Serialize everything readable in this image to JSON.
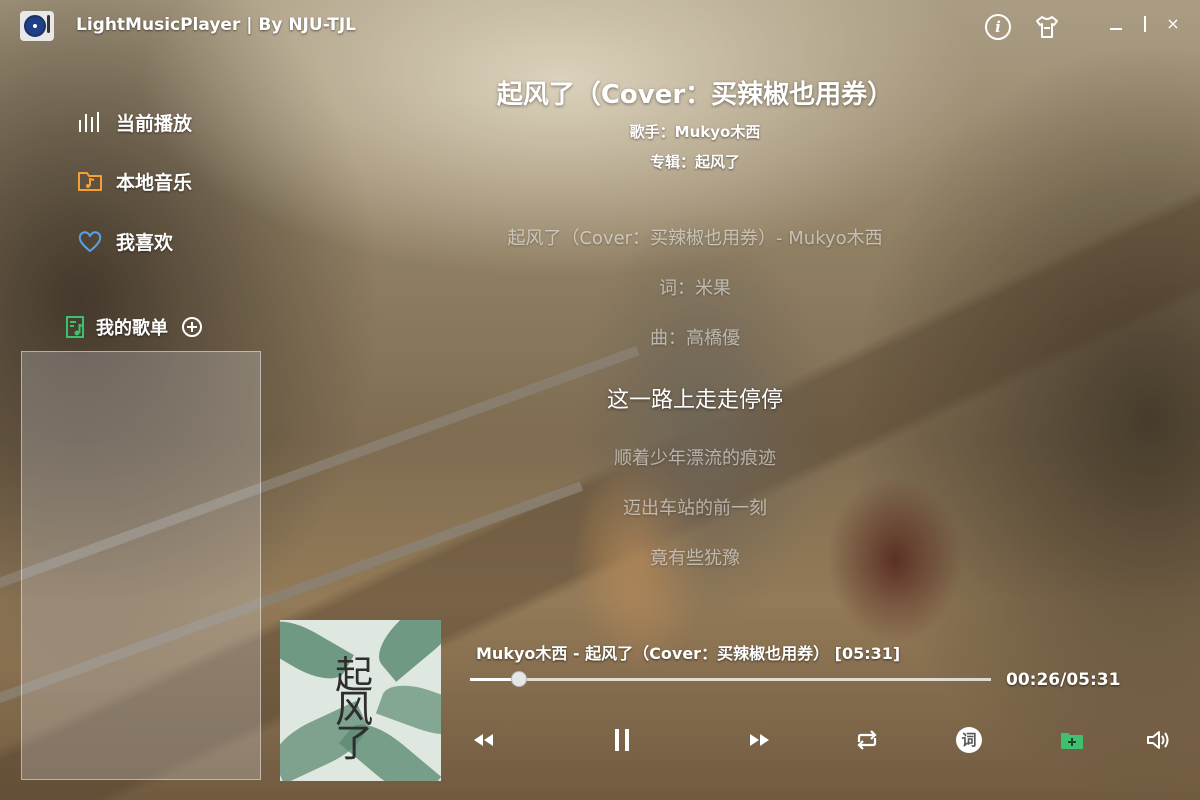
{
  "app": {
    "title": "LightMusicPlayer | By NJU-TJL"
  },
  "titlebar": {
    "info_icon": "info-icon",
    "skin_icon": "tshirt-icon",
    "minimize_icon": "minimize-icon",
    "maximize_icon": "maximize-icon",
    "close_icon": "close-icon",
    "info_glyph": "i",
    "close_glyph": "×"
  },
  "sidebar": {
    "items": [
      {
        "label": "当前播放",
        "icon": "bars-icon"
      },
      {
        "label": "本地音乐",
        "icon": "music-folder-icon"
      },
      {
        "label": "我喜欢",
        "icon": "heart-icon"
      }
    ],
    "playlist_header": "我的歌单",
    "playlist_icon": "playlist-note-icon",
    "add_icon": "plus-circle-icon"
  },
  "song": {
    "title": "起风了（Cover：买辣椒也用券）",
    "artist_line": "歌手：Mukyo木西",
    "album_line": "专辑：起风了"
  },
  "lyrics": {
    "current_index": 3,
    "lines": [
      "起风了（Cover：买辣椒也用券）- Mukyo木西",
      "词：米果",
      "曲：高橋優",
      "这一路上走走停停",
      "顺着少年漂流的痕迹",
      "迈出车站的前一刻",
      "竟有些犹豫"
    ]
  },
  "player": {
    "now_playing": "Mukyo木西 - 起风了（Cover：买辣椒也用券） [05:31]",
    "time_display": "00:26/05:31",
    "progress": 0.0938,
    "cover_text": "起风了",
    "controls": {
      "prev_icon": "previous-icon",
      "pause_icon": "pause-icon",
      "next_icon": "next-icon",
      "repeat_icon": "repeat-icon",
      "lyric_icon": "lyric-icon",
      "playlist_icon": "add-to-playlist-icon",
      "volume_icon": "volume-icon",
      "lyric_glyph": "词"
    }
  },
  "colors": {
    "accent_orange": "#f5a030",
    "accent_blue": "#5aa0e8",
    "accent_green": "#3ec070"
  }
}
